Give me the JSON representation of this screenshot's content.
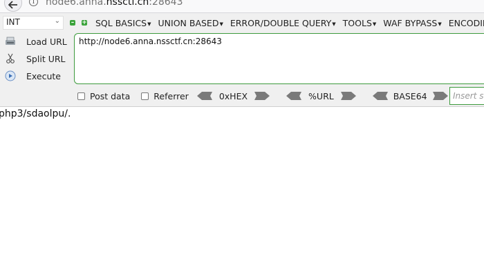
{
  "browser": {
    "url_prefix": "node6.anna.",
    "url_host": "nssctf.cn",
    "url_suffix": ":28643"
  },
  "hackbar": {
    "type_select": "INT",
    "menu": [
      {
        "label": "SQL BASICS"
      },
      {
        "label": "UNION BASED"
      },
      {
        "label": "ERROR/DOUBLE QUERY"
      },
      {
        "label": "TOOLS"
      },
      {
        "label": "WAF BYPASS"
      },
      {
        "label": "ENCODING"
      }
    ],
    "buttons": {
      "load_url": "Load URL",
      "split_url": "Split URL",
      "execute": "Execute"
    },
    "url_value": "http://node6.anna.nssctf.cn:28643",
    "options": {
      "post_data": "Post data",
      "referrer": "Referrer",
      "hex": "0xHEX",
      "url": "%URL",
      "base64": "BASE64"
    },
    "insert_placeholder": "Insert string to replace",
    "accent": "#3c9a3c"
  },
  "page": {
    "body_text": "php3/sdaolpu/."
  }
}
